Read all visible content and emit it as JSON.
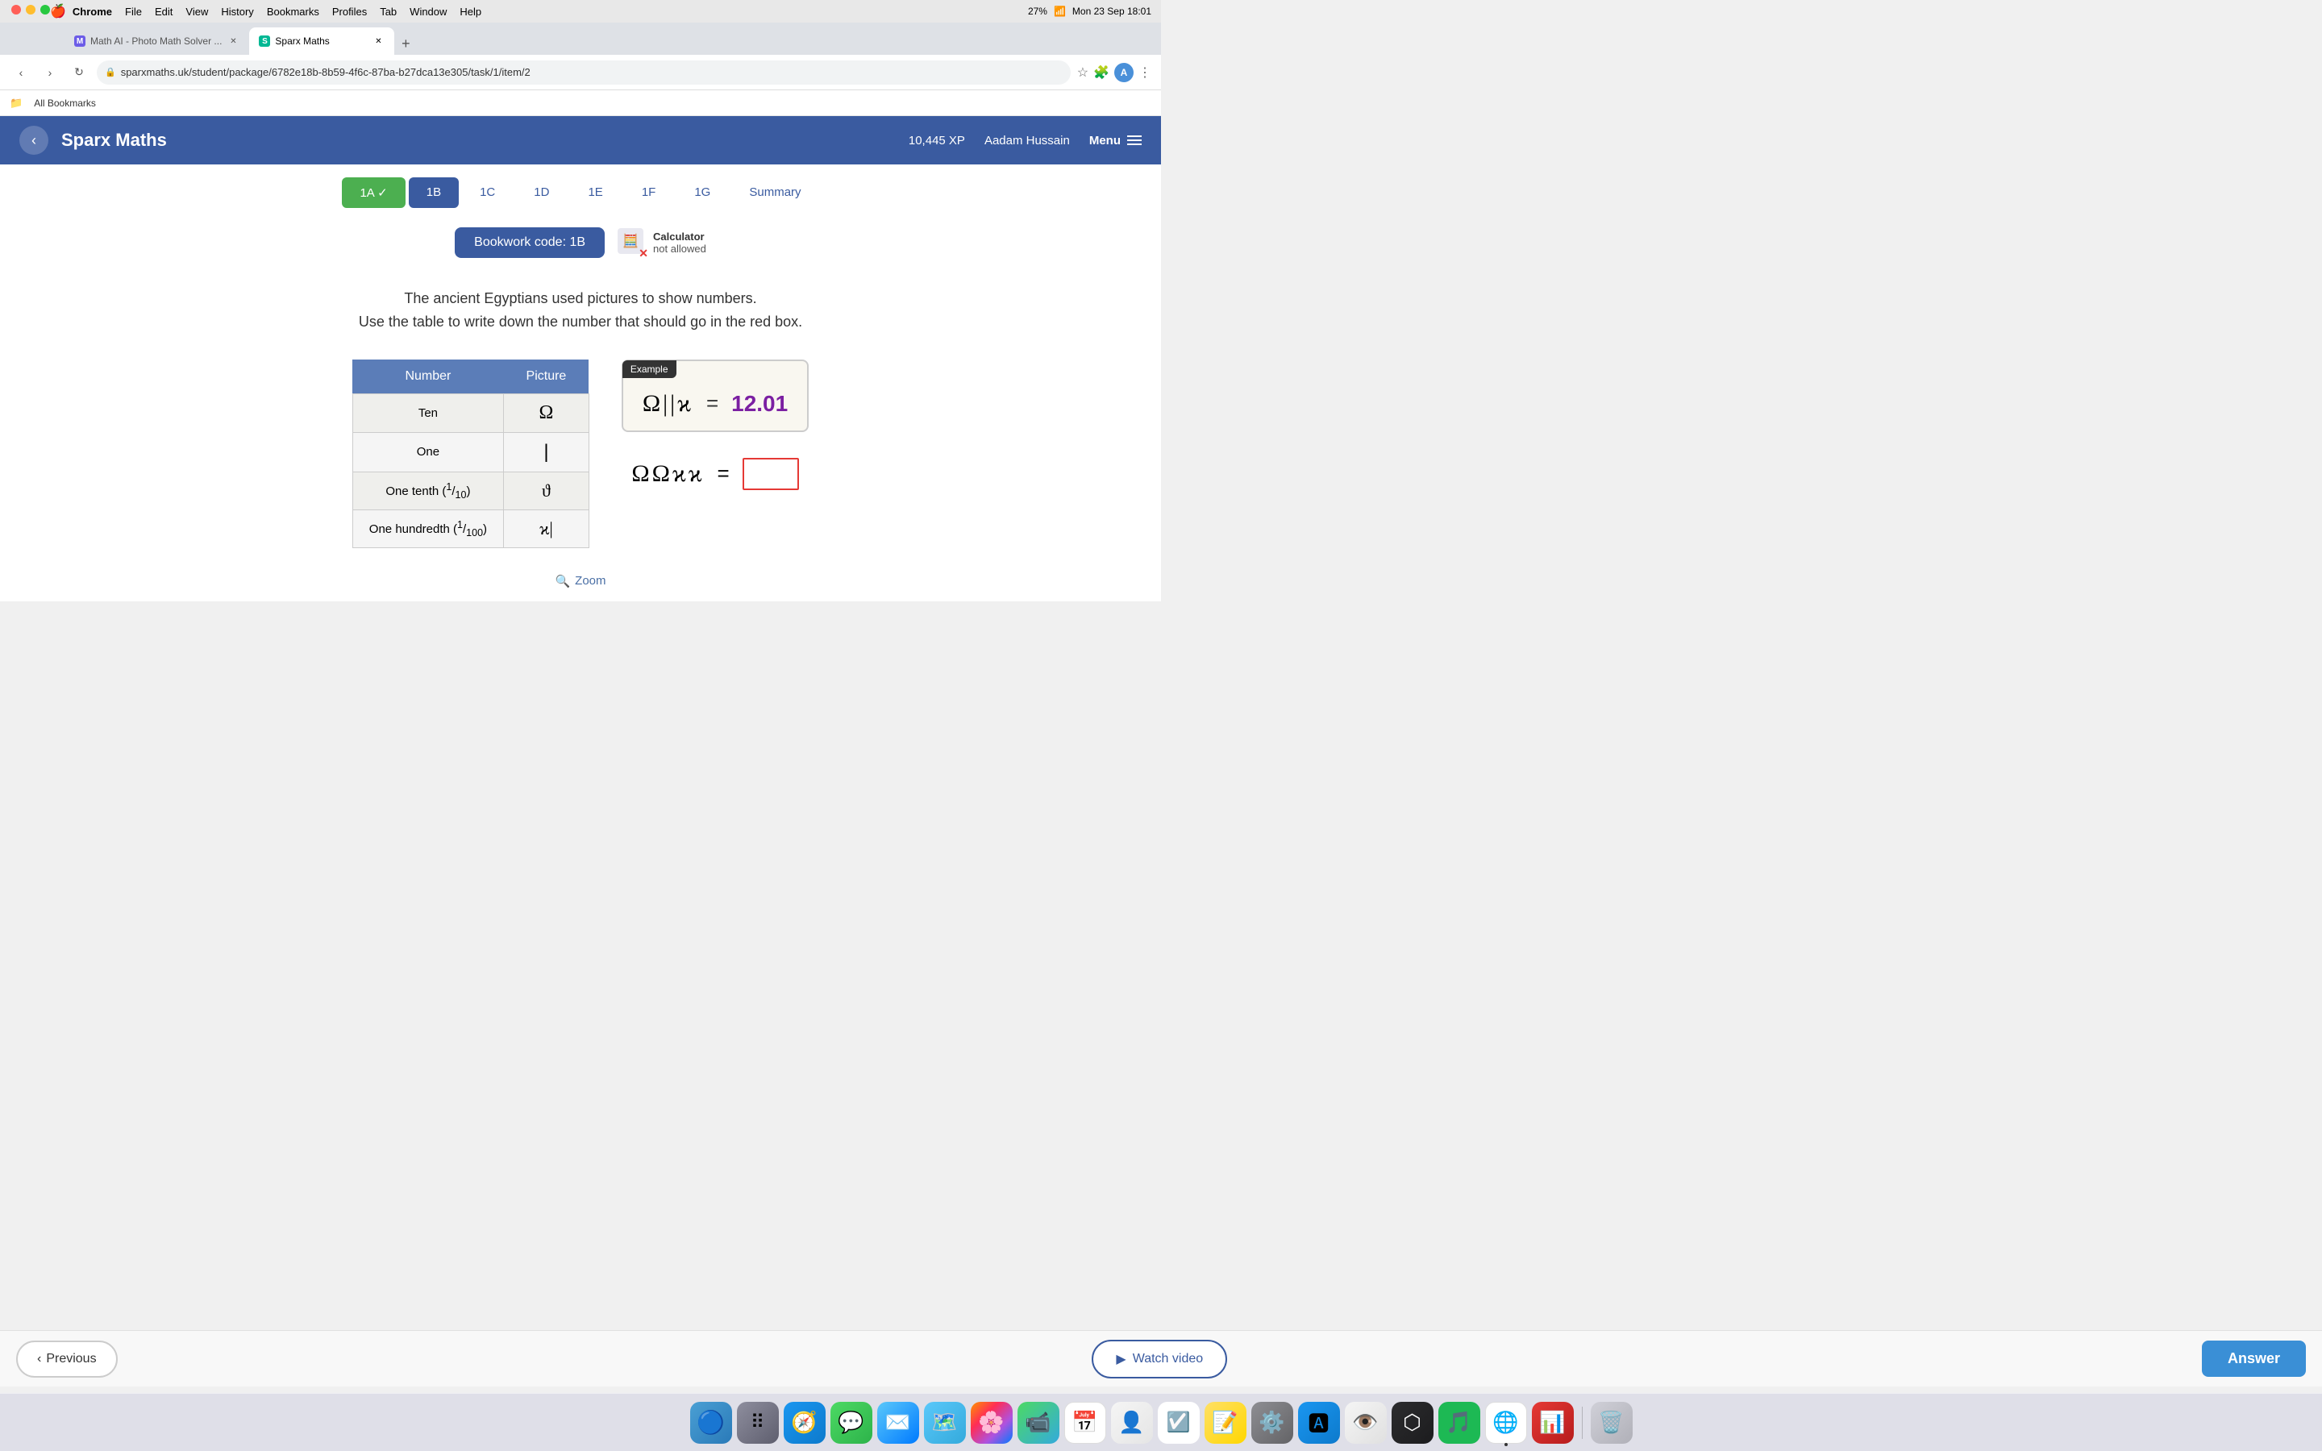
{
  "macbar": {
    "apple": "🍎",
    "app_name": "Chrome",
    "menus": [
      "File",
      "Edit",
      "View",
      "History",
      "Bookmarks",
      "Profiles",
      "Tab",
      "Window",
      "Help"
    ],
    "time": "Mon 23 Sep  18:01",
    "battery": "27%"
  },
  "browser": {
    "tabs": [
      {
        "id": "tab1",
        "favicon_color": "#6c5ce7",
        "title": "Math AI - Photo Math Solver ...",
        "active": false
      },
      {
        "id": "tab2",
        "favicon_color": "#00b894",
        "title": "Sparx Maths",
        "active": true
      }
    ],
    "url": "sparxmaths.uk/student/package/6782e18b-8b59-4f6c-87ba-b27dca13e305/task/1/item/2",
    "bookmark_label": "All Bookmarks"
  },
  "sparx": {
    "title": "Sparx Maths",
    "xp": "10,445 XP",
    "user": "Aadam Hussain",
    "menu_label": "Menu",
    "tabs": [
      {
        "id": "1A",
        "label": "1A",
        "state": "done"
      },
      {
        "id": "1B",
        "label": "1B",
        "state": "active"
      },
      {
        "id": "1C",
        "label": "1C",
        "state": "inactive"
      },
      {
        "id": "1D",
        "label": "1D",
        "state": "inactive"
      },
      {
        "id": "1E",
        "label": "1E",
        "state": "inactive"
      },
      {
        "id": "1F",
        "label": "1F",
        "state": "inactive"
      },
      {
        "id": "1G",
        "label": "1G",
        "state": "inactive"
      },
      {
        "id": "summary",
        "label": "Summary",
        "state": "inactive"
      }
    ],
    "bookwork_code": "Bookwork code: 1B",
    "calculator_label": "Calculator",
    "calculator_status": "not allowed",
    "question_line1": "The ancient Egyptians used pictures to show numbers.",
    "question_line2": "Use the table to write down the number that should go in the red box.",
    "table": {
      "col1": "Number",
      "col2": "Picture",
      "rows": [
        {
          "number": "Ten",
          "symbol": "Ω",
          "symbol_type": "ten"
        },
        {
          "number": "One",
          "symbol": "|",
          "symbol_type": "one"
        },
        {
          "number_html": "One tenth (¹⁄₁₀)",
          "number": "One tenth",
          "symbol": "ϑ",
          "symbol_type": "tenth"
        },
        {
          "number_html": "One hundredth (¹⁄₁₀₀)",
          "number": "One hundredth",
          "symbol": "ϰ|",
          "symbol_type": "hundredth"
        }
      ]
    },
    "example": {
      "label": "Example",
      "symbols": "Ω||ϰ",
      "equals": "=",
      "result": "12.01"
    },
    "question": {
      "symbols": "ΩΩϰϰ",
      "equals": "="
    },
    "zoom_label": "Zoom",
    "prev_label": "Previous",
    "watch_label": "Watch video",
    "answer_label": "Answer"
  },
  "dock": {
    "apps": [
      {
        "name": "Finder",
        "emoji": "🔍",
        "color": "#4a9fd4"
      },
      {
        "name": "Launchpad",
        "emoji": "🚀",
        "color": "#8e8e9e"
      },
      {
        "name": "Safari",
        "emoji": "🧭",
        "color": "#1a96f0"
      },
      {
        "name": "Messages",
        "emoji": "💬",
        "color": "#4cd964"
      },
      {
        "name": "Mail",
        "emoji": "✉️",
        "color": "#5ac8fa"
      },
      {
        "name": "Maps",
        "emoji": "🗺️",
        "color": "#5ac8fa"
      },
      {
        "name": "Photos",
        "emoji": "🌸",
        "color": "#ff9500"
      },
      {
        "name": "FaceTime",
        "emoji": "📹",
        "color": "#4cd964"
      },
      {
        "name": "Calendar",
        "emoji": "📅",
        "color": "#fff"
      },
      {
        "name": "Contacts",
        "emoji": "👤",
        "color": "#f5f5f5"
      },
      {
        "name": "Reminders",
        "emoji": "☑️",
        "color": "#fff"
      },
      {
        "name": "Notes",
        "emoji": "📝",
        "color": "#ffe066"
      },
      {
        "name": "Settings",
        "emoji": "⚙️",
        "color": "#8e8e93"
      },
      {
        "name": "App Store",
        "emoji": "🅰️",
        "color": "#1a96f0"
      },
      {
        "name": "Preview",
        "emoji": "👁️",
        "color": "#f5f5f5"
      },
      {
        "name": "Plasticity",
        "emoji": "⬡",
        "color": "#2c2c2e"
      },
      {
        "name": "Spotify",
        "emoji": "🎵",
        "color": "#1db954"
      },
      {
        "name": "Chrome",
        "emoji": "🌐",
        "color": "#fff",
        "active": true
      },
      {
        "name": "Keewordz",
        "emoji": "📊",
        "color": "#e53935"
      },
      {
        "name": "Trash",
        "emoji": "🗑️",
        "color": "#d0d0d8"
      }
    ]
  }
}
